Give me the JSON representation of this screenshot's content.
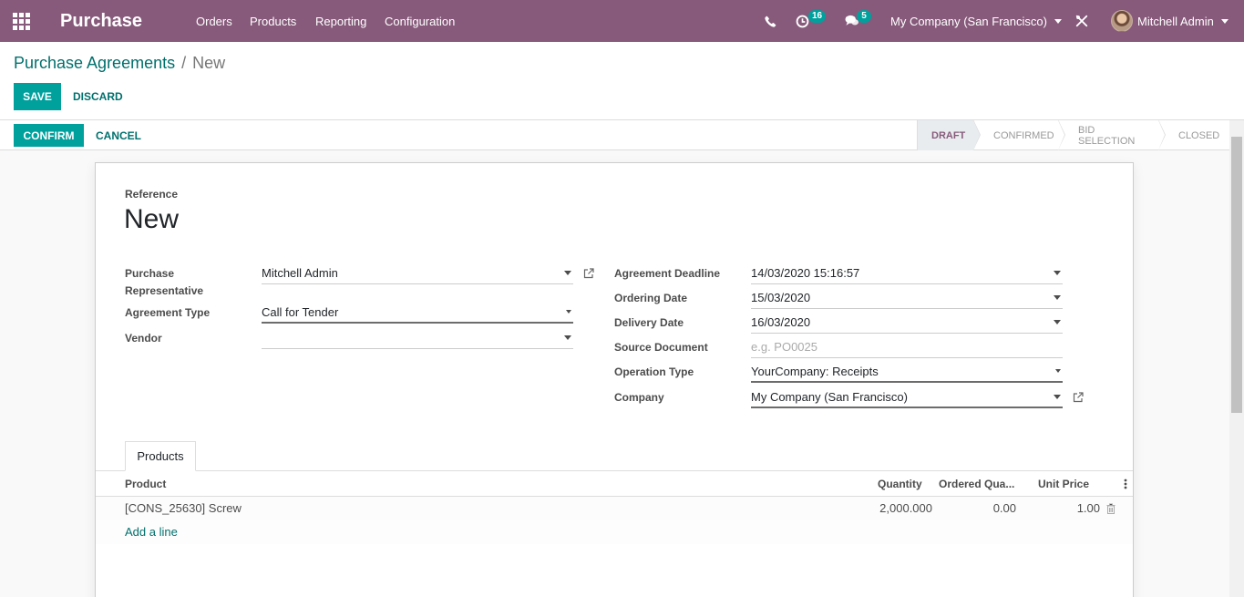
{
  "navbar": {
    "app_name": "Purchase",
    "menu": [
      "Orders",
      "Products",
      "Reporting",
      "Configuration"
    ],
    "activities_count": "16",
    "messages_count": "5",
    "company": "My Company (San Francisco)",
    "user": "Mitchell Admin",
    "color": "#875a7b"
  },
  "breadcrumb": {
    "parent": "Purchase Agreements",
    "separator": "/",
    "current": "New"
  },
  "actions": {
    "save": "SAVE",
    "discard": "DISCARD"
  },
  "statusbar": {
    "confirm": "CONFIRM",
    "cancel": "CANCEL",
    "stages": [
      "DRAFT",
      "CONFIRMED",
      "BID SELECTION",
      "CLOSED"
    ],
    "active_stage": "DRAFT"
  },
  "form": {
    "reference_label": "Reference",
    "reference_value": "New",
    "left": {
      "purchase_rep_label_1": "Purchase",
      "purchase_rep_label_2": "Representative",
      "purchase_rep_value": "Mitchell Admin",
      "agreement_type_label": "Agreement Type",
      "agreement_type_value": "Call for Tender",
      "vendor_label": "Vendor",
      "vendor_value": ""
    },
    "right": {
      "deadline_label": "Agreement Deadline",
      "deadline_value": "14/03/2020 15:16:57",
      "ordering_date_label": "Ordering Date",
      "ordering_date_value": "15/03/2020",
      "delivery_date_label": "Delivery Date",
      "delivery_date_value": "16/03/2020",
      "source_doc_label": "Source Document",
      "source_doc_placeholder": "e.g. PO0025",
      "operation_type_label": "Operation Type",
      "operation_type_value": "YourCompany: Receipts",
      "company_label": "Company",
      "company_value": "My Company (San Francisco)"
    }
  },
  "tabs": {
    "products": "Products"
  },
  "lines_table": {
    "columns": [
      "Product",
      "Quantity",
      "Ordered Qua...",
      "Unit Price"
    ],
    "rows": [
      {
        "product": "[CONS_25630] Screw",
        "quantity": "2,000.000",
        "ordered": "0.00",
        "unit_price": "1.00"
      }
    ],
    "add_line": "Add a line"
  },
  "colors": {
    "primary": "#00a09d",
    "link": "#00706d",
    "brand": "#875a7b"
  }
}
